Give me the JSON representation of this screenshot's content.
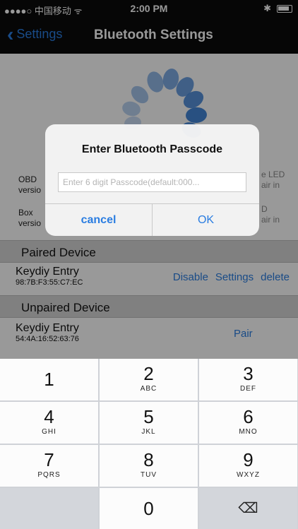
{
  "status_bar": {
    "carrier": "●●●●○ 中国移动 ᯤ",
    "time": "2:00 PM",
    "bluetooth": "✱"
  },
  "nav": {
    "back_label": "Settings",
    "title": "Bluetooth Settings"
  },
  "side_texts": {
    "left_top": [
      "OBD",
      "versio"
    ],
    "left_bottom": [
      "Box",
      "versio"
    ],
    "right_top": [
      "e LED",
      "air in"
    ],
    "right_bottom": [
      "D",
      "air in"
    ]
  },
  "paired_section": "Paired Device",
  "paired_device": {
    "name": "Keydiy Entry",
    "mac": "98:7B:F3:55:C7:EC",
    "actions": [
      "Disable",
      "Settings",
      "delete"
    ]
  },
  "unpaired_section": "Unpaired Device",
  "unpaired_device": {
    "name": "Keydiy Entry",
    "mac": "54:4A:16:52:63:76",
    "action": "Pair"
  },
  "alert": {
    "title": "Enter Bluetooth Passcode",
    "placeholder": "Enter 6 digit Passcode(default:000...",
    "cancel_label": "cancel",
    "ok_label": "OK"
  },
  "keypad": {
    "keys": [
      {
        "num": "1",
        "letters": ""
      },
      {
        "num": "2",
        "letters": "ABC"
      },
      {
        "num": "3",
        "letters": "DEF"
      },
      {
        "num": "4",
        "letters": "GHI"
      },
      {
        "num": "5",
        "letters": "JKL"
      },
      {
        "num": "6",
        "letters": "MNO"
      },
      {
        "num": "7",
        "letters": "PQRS"
      },
      {
        "num": "8",
        "letters": "TUV"
      },
      {
        "num": "9",
        "letters": "WXYZ"
      },
      {
        "num": "0",
        "letters": ""
      }
    ],
    "delete_icon": "⌫"
  },
  "colors": {
    "accent": "#2a7de1",
    "spinner": "#3a7fd5"
  }
}
